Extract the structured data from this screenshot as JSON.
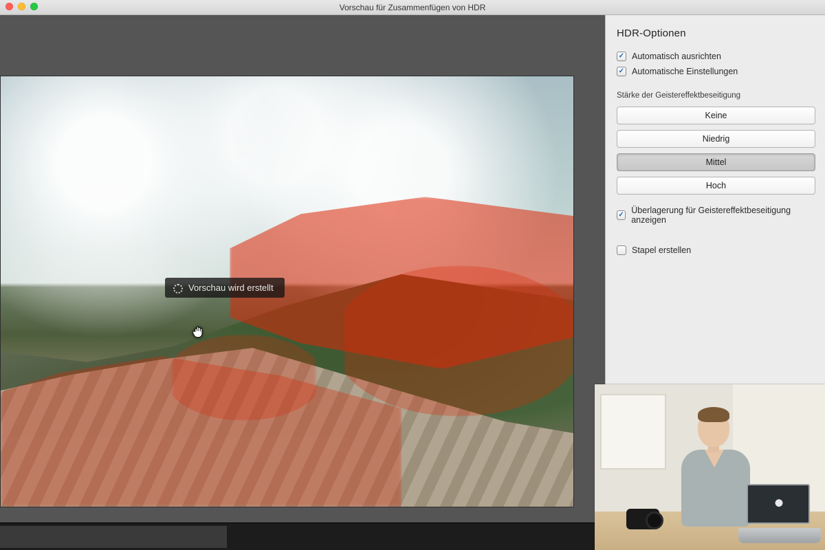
{
  "titlebar": {
    "title": "Vorschau für Zusammenfügen von HDR"
  },
  "preview": {
    "loading_text": "Vorschau wird erstellt"
  },
  "panel": {
    "title": "HDR-Optionen",
    "auto_align_label": "Automatisch ausrichten",
    "auto_settings_label": "Automatische Einstellungen",
    "deghost_section_label": "Stärke der Geistereffektbeseitigung",
    "deghost_levels": {
      "none": "Keine",
      "low": "Niedrig",
      "medium": "Mittel",
      "high": "Hoch"
    },
    "show_overlay_label": "Überlagerung für Geistereffektbeseitigung anzeigen",
    "create_stack_label": "Stapel erstellen",
    "checks": {
      "auto_align": true,
      "auto_settings": true,
      "show_overlay": true,
      "create_stack": false
    },
    "selected_deghost": "medium"
  }
}
